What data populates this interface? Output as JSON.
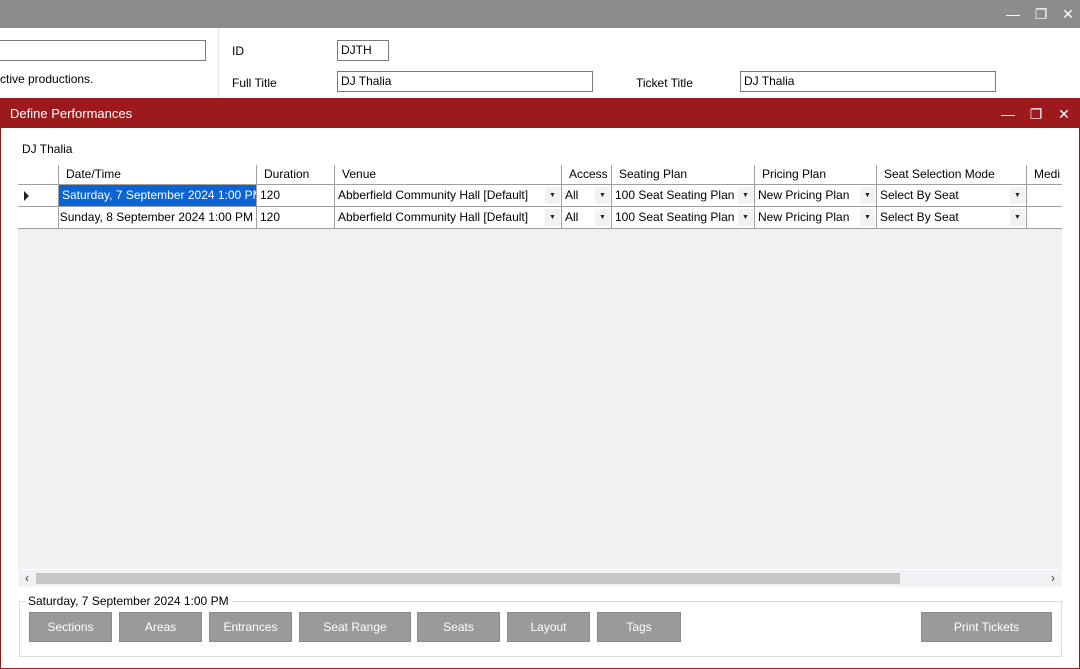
{
  "background_window": {
    "controls": {
      "minimize": "—",
      "maximize": "❐",
      "close": "✕"
    },
    "left_text": "ctive productions.",
    "id_label": "ID",
    "id_value": "DJTH",
    "full_title_label": "Full Title",
    "full_title_value": "DJ Thalia",
    "ticket_title_label": "Ticket Title",
    "ticket_title_value": "DJ Thalia"
  },
  "dialog": {
    "title": "Define Performances",
    "controls": {
      "minimize": "—",
      "maximize": "❐",
      "close": "✕"
    },
    "production_name": "DJ Thalia",
    "grid": {
      "columns": [
        "Date/Time",
        "Duration",
        "Venue",
        "Access",
        "Seating Plan",
        "Pricing Plan",
        "Seat Selection Mode",
        "Medi"
      ],
      "rows": [
        {
          "datetime": "Saturday, 7 September 2024 1:00 PM",
          "duration": "120",
          "venue": "Abberfield Community Hall [Default]",
          "access": "All",
          "seating_plan": "100 Seat Seating Plan",
          "pricing_plan": "New Pricing Plan",
          "seat_selection_mode": "Select By Seat",
          "selected": true
        },
        {
          "datetime": "Sunday, 8 September 2024 1:00 PM",
          "duration": "120",
          "venue": "Abberfield Community Hall [Default]",
          "access": "All",
          "seating_plan": "100 Seat Seating Plan",
          "pricing_plan": "New Pricing Plan",
          "seat_selection_mode": "Select By Seat",
          "selected": false
        }
      ]
    },
    "scrollbar": {
      "left_arrow": "‹",
      "right_arrow": "›"
    },
    "group": {
      "title": "Saturday, 7 September 2024 1:00 PM",
      "buttons": {
        "sections": "Sections",
        "areas": "Areas",
        "entrances": "Entrances",
        "seat_range": "Seat Range",
        "seats": "Seats",
        "layout": "Layout",
        "tags": "Tags",
        "print_tickets": "Print Tickets"
      }
    }
  },
  "colors": {
    "dialog_title_bg": "#9c1a1c",
    "background_title_bg": "#8c8c8c",
    "selection": "#0a64d6",
    "button_bg": "#9a9a9a"
  }
}
